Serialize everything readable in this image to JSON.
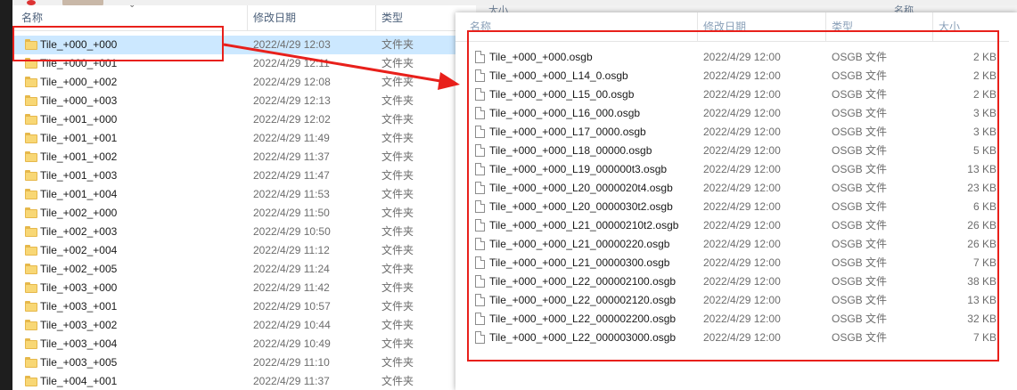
{
  "left_window": {
    "headers": {
      "name": "名称",
      "date": "修改日期",
      "type": "类型"
    },
    "rows": [
      {
        "name": "Tile_+000_+000",
        "date": "2022/4/29 12:03",
        "type": "文件夹",
        "selected": true
      },
      {
        "name": "Tile_+000_+001",
        "date": "2022/4/29 12:11",
        "type": "文件夹"
      },
      {
        "name": "Tile_+000_+002",
        "date": "2022/4/29 12:08",
        "type": "文件夹"
      },
      {
        "name": "Tile_+000_+003",
        "date": "2022/4/29 12:13",
        "type": "文件夹"
      },
      {
        "name": "Tile_+001_+000",
        "date": "2022/4/29 12:02",
        "type": "文件夹"
      },
      {
        "name": "Tile_+001_+001",
        "date": "2022/4/29 11:49",
        "type": "文件夹"
      },
      {
        "name": "Tile_+001_+002",
        "date": "2022/4/29 11:37",
        "type": "文件夹"
      },
      {
        "name": "Tile_+001_+003",
        "date": "2022/4/29 11:47",
        "type": "文件夹"
      },
      {
        "name": "Tile_+001_+004",
        "date": "2022/4/29 11:53",
        "type": "文件夹"
      },
      {
        "name": "Tile_+002_+000",
        "date": "2022/4/29 11:50",
        "type": "文件夹"
      },
      {
        "name": "Tile_+002_+003",
        "date": "2022/4/29 10:50",
        "type": "文件夹"
      },
      {
        "name": "Tile_+002_+004",
        "date": "2022/4/29 11:12",
        "type": "文件夹"
      },
      {
        "name": "Tile_+002_+005",
        "date": "2022/4/29 11:24",
        "type": "文件夹"
      },
      {
        "name": "Tile_+003_+000",
        "date": "2022/4/29 11:42",
        "type": "文件夹"
      },
      {
        "name": "Tile_+003_+001",
        "date": "2022/4/29 10:57",
        "type": "文件夹"
      },
      {
        "name": "Tile_+003_+002",
        "date": "2022/4/29 10:44",
        "type": "文件夹"
      },
      {
        "name": "Tile_+003_+004",
        "date": "2022/4/29 10:49",
        "type": "文件夹"
      },
      {
        "name": "Tile_+003_+005",
        "date": "2022/4/29 11:10",
        "type": "文件夹"
      },
      {
        "name": "Tile_+004_+001",
        "date": "2022/4/29 11:37",
        "type": "文件夹"
      }
    ]
  },
  "right_window": {
    "headers": {
      "name": "名称",
      "date": "修改日期",
      "type": "类型",
      "size": "大小"
    },
    "rows": [
      {
        "name": "Tile_+000_+000.osgb",
        "date": "2022/4/29 12:00",
        "type": "OSGB 文件",
        "size": "2 KB"
      },
      {
        "name": "Tile_+000_+000_L14_0.osgb",
        "date": "2022/4/29 12:00",
        "type": "OSGB 文件",
        "size": "2 KB"
      },
      {
        "name": "Tile_+000_+000_L15_00.osgb",
        "date": "2022/4/29 12:00",
        "type": "OSGB 文件",
        "size": "2 KB"
      },
      {
        "name": "Tile_+000_+000_L16_000.osgb",
        "date": "2022/4/29 12:00",
        "type": "OSGB 文件",
        "size": "3 KB"
      },
      {
        "name": "Tile_+000_+000_L17_0000.osgb",
        "date": "2022/4/29 12:00",
        "type": "OSGB 文件",
        "size": "3 KB"
      },
      {
        "name": "Tile_+000_+000_L18_00000.osgb",
        "date": "2022/4/29 12:00",
        "type": "OSGB 文件",
        "size": "5 KB"
      },
      {
        "name": "Tile_+000_+000_L19_000000t3.osgb",
        "date": "2022/4/29 12:00",
        "type": "OSGB 文件",
        "size": "13 KB"
      },
      {
        "name": "Tile_+000_+000_L20_0000020t4.osgb",
        "date": "2022/4/29 12:00",
        "type": "OSGB 文件",
        "size": "23 KB"
      },
      {
        "name": "Tile_+000_+000_L20_0000030t2.osgb",
        "date": "2022/4/29 12:00",
        "type": "OSGB 文件",
        "size": "6 KB"
      },
      {
        "name": "Tile_+000_+000_L21_00000210t2.osgb",
        "date": "2022/4/29 12:00",
        "type": "OSGB 文件",
        "size": "26 KB"
      },
      {
        "name": "Tile_+000_+000_L21_00000220.osgb",
        "date": "2022/4/29 12:00",
        "type": "OSGB 文件",
        "size": "26 KB"
      },
      {
        "name": "Tile_+000_+000_L21_00000300.osgb",
        "date": "2022/4/29 12:00",
        "type": "OSGB 文件",
        "size": "7 KB"
      },
      {
        "name": "Tile_+000_+000_L22_000002100.osgb",
        "date": "2022/4/29 12:00",
        "type": "OSGB 文件",
        "size": "38 KB"
      },
      {
        "name": "Tile_+000_+000_L22_000002120.osgb",
        "date": "2022/4/29 12:00",
        "type": "OSGB 文件",
        "size": "13 KB"
      },
      {
        "name": "Tile_+000_+000_L22_000002200.osgb",
        "date": "2022/4/29 12:00",
        "type": "OSGB 文件",
        "size": "32 KB"
      },
      {
        "name": "Tile_+000_+000_L22_000003000.osgb",
        "date": "2022/4/29 12:00",
        "type": "OSGB 文件",
        "size": "7 KB"
      }
    ]
  },
  "behind_window": {
    "col_size": "大小",
    "col_name": "名称"
  },
  "colors": {
    "annotation_red": "#e8201b",
    "selection_blue": "#cce8ff",
    "folder_yellow": "#f8d775"
  }
}
